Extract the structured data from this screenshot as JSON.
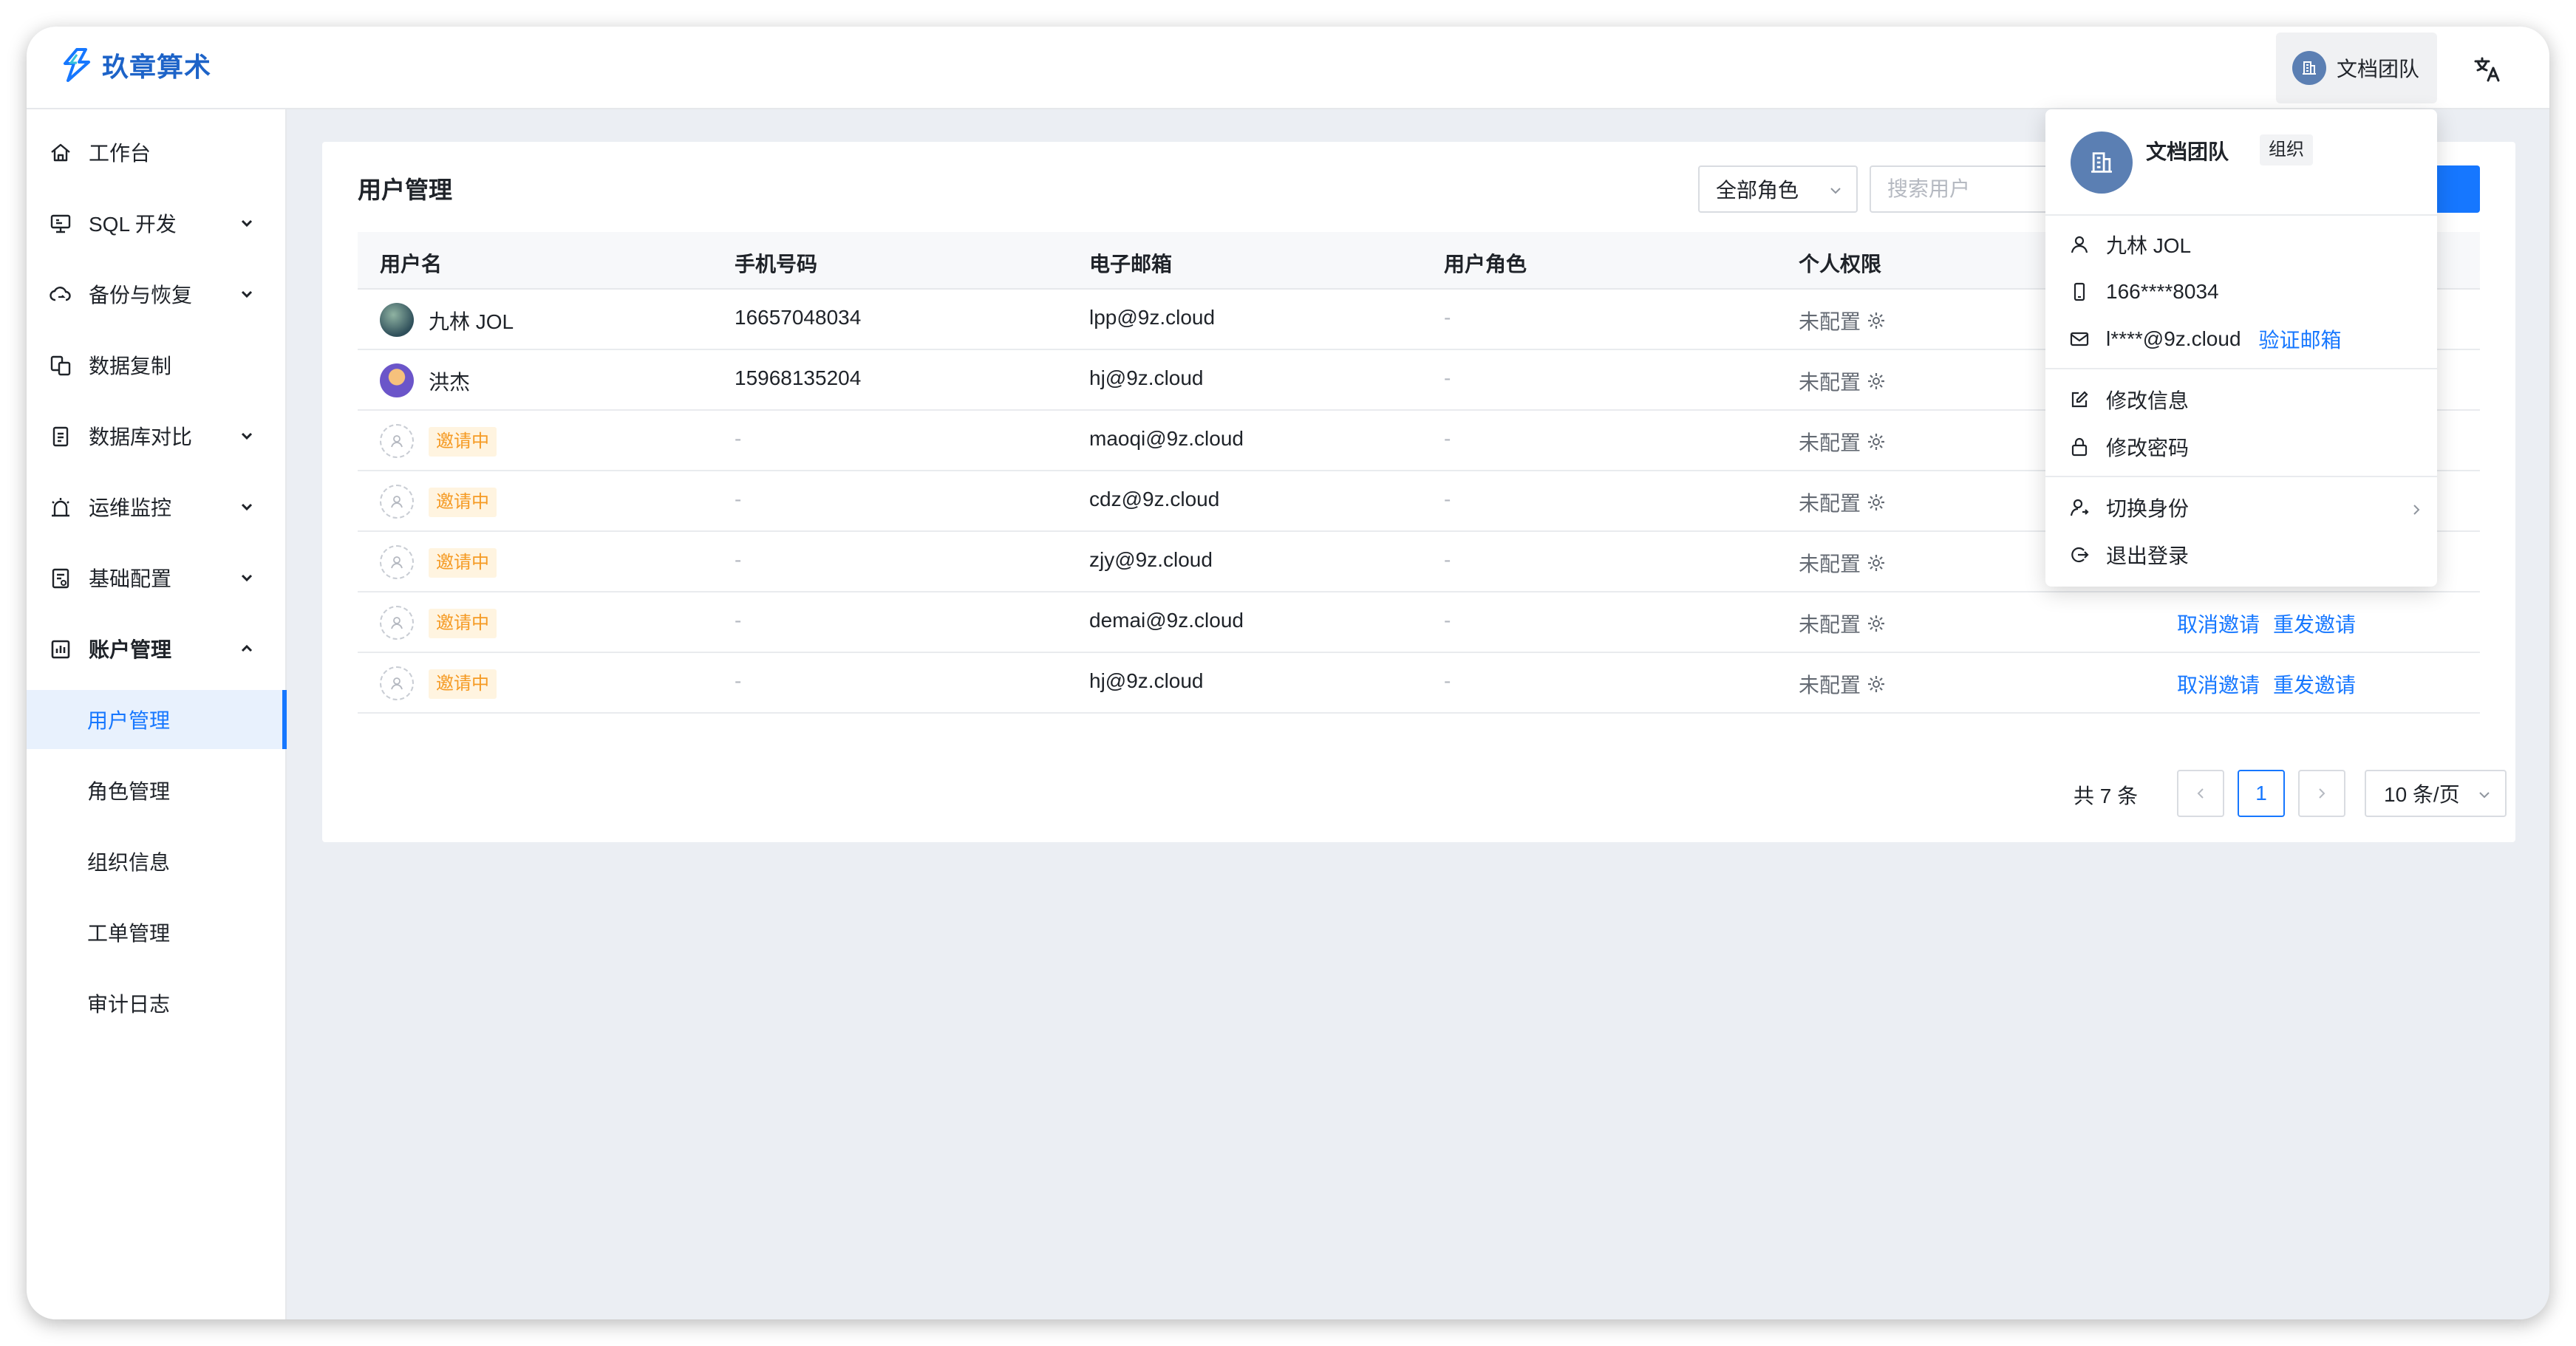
{
  "app": {
    "brand": "玖章算术"
  },
  "header": {
    "account_name": "文档团队"
  },
  "sidebar": {
    "items": [
      {
        "label": "工作台"
      },
      {
        "label": "SQL 开发"
      },
      {
        "label": "备份与恢复"
      },
      {
        "label": "数据复制"
      },
      {
        "label": "数据库对比"
      },
      {
        "label": "运维监控"
      },
      {
        "label": "基础配置"
      },
      {
        "label": "账户管理"
      }
    ],
    "sub_items": [
      {
        "label": "用户管理"
      },
      {
        "label": "角色管理"
      },
      {
        "label": "组织信息"
      },
      {
        "label": "工单管理"
      },
      {
        "label": "审计日志"
      }
    ],
    "active_sub_item": "用户管理"
  },
  "main": {
    "title": "用户管理",
    "role_filter": "全部角色",
    "search_placeholder": "搜索用户"
  },
  "table": {
    "columns": [
      "用户名",
      "手机号码",
      "电子邮箱",
      "用户角色",
      "个人权限"
    ],
    "rows": [
      {
        "name": "九林 JOL",
        "phone": "16657048034",
        "email": "lpp@9z.cloud",
        "role": "-",
        "perm": "未配置"
      },
      {
        "name": "洪杰",
        "phone": "15968135204",
        "email": "hj@9z.cloud",
        "role": "-",
        "perm": "未配置"
      },
      {
        "status": "邀请中",
        "phone": "-",
        "email": "maoqi@9z.cloud",
        "role": "-",
        "perm": "未配置"
      },
      {
        "status": "邀请中",
        "phone": "-",
        "email": "cdz@9z.cloud",
        "role": "-",
        "perm": "未配置"
      },
      {
        "status": "邀请中",
        "phone": "-",
        "email": "zjy@9z.cloud",
        "role": "-",
        "perm": "未配置"
      },
      {
        "status": "邀请中",
        "phone": "-",
        "email": "demai@9z.cloud",
        "role": "-",
        "perm": "未配置",
        "actions": [
          "取消邀请",
          "重发邀请"
        ]
      },
      {
        "status": "邀请中",
        "phone": "-",
        "email": "hj@9z.cloud",
        "role": "-",
        "perm": "未配置",
        "actions": [
          "取消邀请",
          "重发邀请"
        ]
      }
    ]
  },
  "pagination": {
    "total": "共 7 条",
    "current": "1",
    "page_size": "10 条/页"
  },
  "popup": {
    "org_name": "文档团队",
    "org_tag": "组织",
    "user": "九林 JOL",
    "phone": "166****8034",
    "email": "l****@9z.cloud",
    "verify_email": "验证邮箱",
    "edit_info": "修改信息",
    "change_password": "修改密码",
    "switch_identity": "切换身份",
    "logout": "退出登录"
  },
  "colors": {
    "accent": "#1677ff",
    "brand": "#1d63c8",
    "pending_badge": "#f59a23"
  }
}
